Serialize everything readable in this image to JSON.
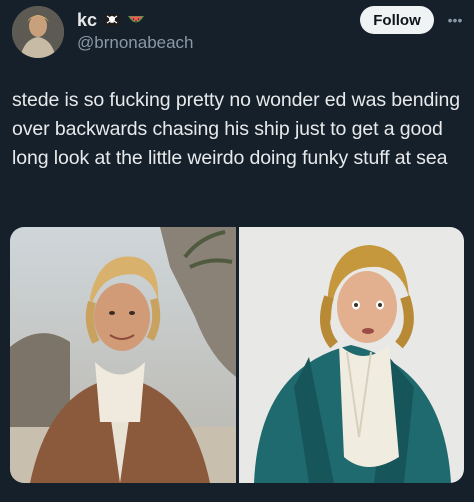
{
  "user": {
    "display_name": "kc",
    "handle": "@brnonabeach",
    "badges": [
      "pirate-flag-icon",
      "watermelon-icon"
    ]
  },
  "actions": {
    "follow_label": "Follow",
    "more_icon": "more-icon"
  },
  "tweet": {
    "text": "stede is so fucking pretty no wonder ed was bending over backwards chasing his ship just to get a good long look at the little weirdo doing funky stuff at sea"
  },
  "colors": {
    "background": "#15202b",
    "text_primary": "#e7e9ea",
    "text_secondary": "#8b98a5",
    "follow_bg": "#eff3f4"
  }
}
